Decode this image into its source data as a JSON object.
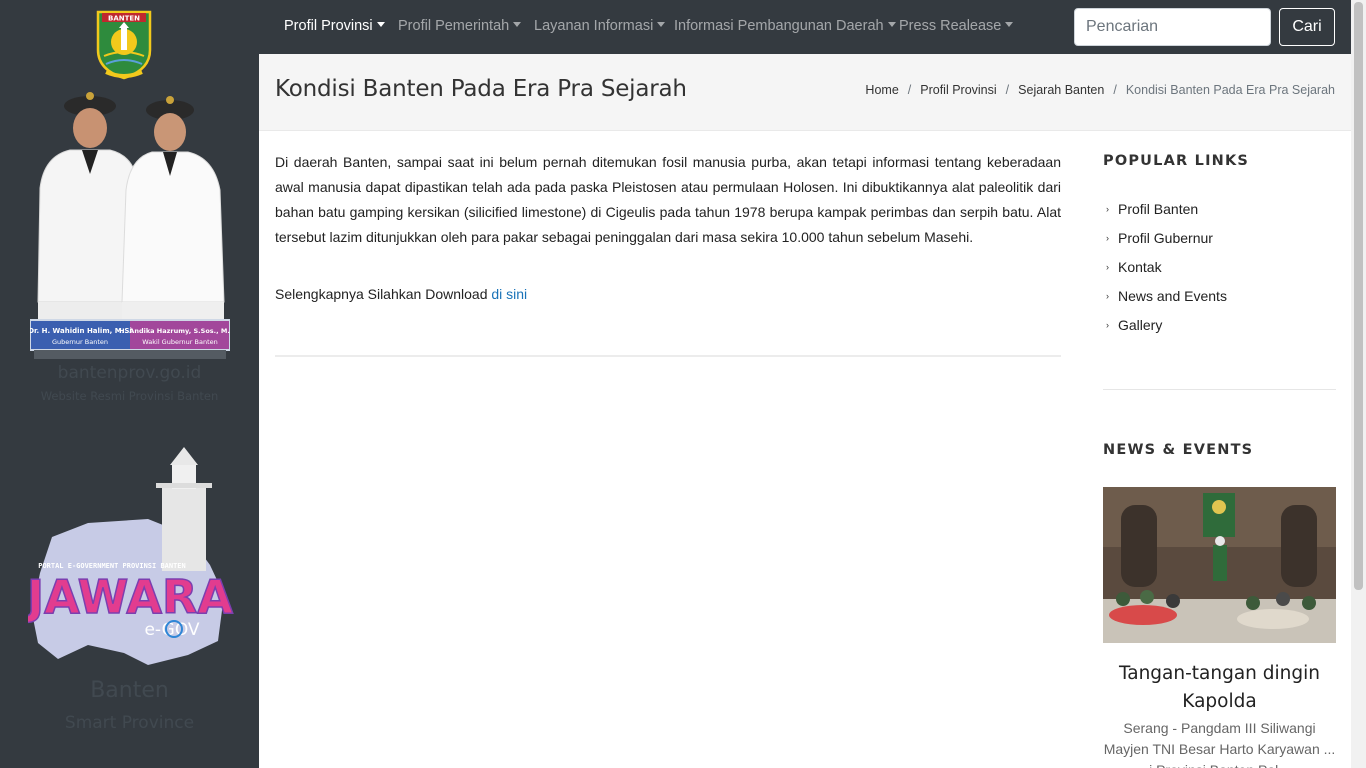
{
  "sidebar": {
    "crest_text": "BANTEN",
    "gov_name": "Dr. H. Wahidin Halim, M.Si",
    "gov_role": "Gubernur Banten",
    "vice_name": "H. Andika Hazrumy, S.Sos., M.AP.",
    "vice_role": "Wakil Gubernur Banten",
    "domain": "bantenprov.go.id",
    "tagline": "Website Resmi Provinsi Banten",
    "jawara_portal": "PORTAL E-GOVERNMENT PROVINSI BANTEN",
    "jawara_word": "JAWARA",
    "jawara_sub": "e-GOV",
    "brand_title": "Banten",
    "brand_sub": "Smart Province"
  },
  "nav": {
    "items": [
      {
        "label": "Profil Provinsi",
        "active": true
      },
      {
        "label": "Profil Pemerintah",
        "active": false
      },
      {
        "label": "Layanan Informasi",
        "active": false
      },
      {
        "label": "Informasi Pembangunan Daerah",
        "active": false
      },
      {
        "label": "Press Realease",
        "active": false
      }
    ],
    "search_placeholder": "Pencarian",
    "search_button": "Cari"
  },
  "header": {
    "title": "Kondisi Banten Pada Era Pra Sejarah",
    "breadcrumb": [
      "Home",
      "Profil Provinsi",
      "Sejarah Banten",
      "Kondisi Banten Pada Era Pra Sejarah"
    ]
  },
  "article": {
    "body": "Di daerah Banten, sampai saat ini belum pernah ditemukan fosil manusia purba, akan tetapi informasi tentang keberadaan awal manusia dapat dipastikan telah ada pada paska Pleistosen atau permulaan Holosen. Ini dibuktikannya alat paleolitik dari bahan batu gamping kersikan (silicified limestone) di Cigeulis pada tahun 1978 berupa kampak perimbas dan serpih batu. Alat tersebut lazim ditunjukkan oleh para pakar sebagai peninggalan dari masa sekira 10.000 tahun sebelum Masehi.",
    "download_prefix": "Selengkapnya Silahkan Download ",
    "download_link": "di sini"
  },
  "popular_links": {
    "title": "POPULAR LINKS",
    "items": [
      "Profil Banten",
      "Profil Gubernur",
      "Kontak",
      "News and Events",
      "Gallery"
    ]
  },
  "news": {
    "title": "NEWS & EVENTS",
    "item_title": "Tangan-tangan dingin Kapolda",
    "item_excerpt": "Serang - Pangdam III Siliwangi Mayjen TNI Besar Harto Karyawan ... i Provinsi Banten Pal..."
  }
}
